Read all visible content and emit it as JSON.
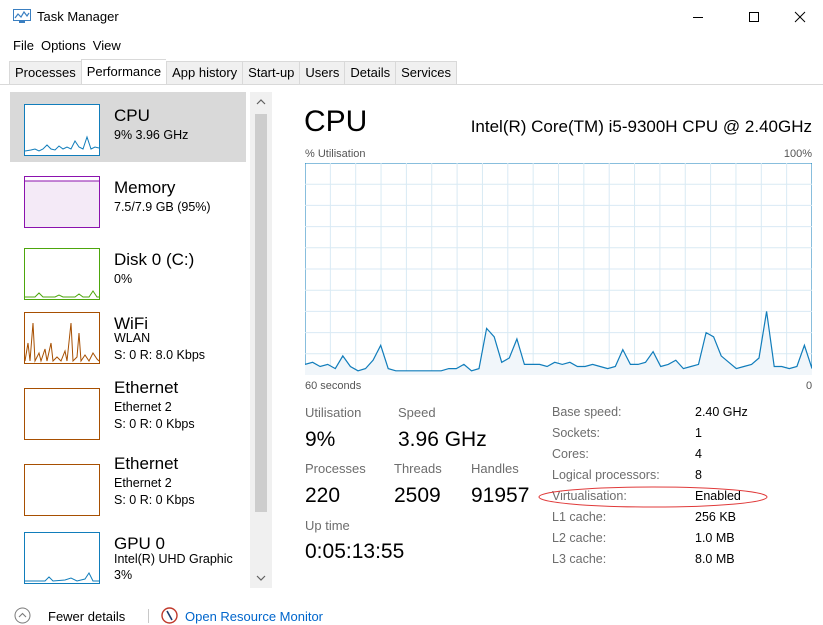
{
  "window": {
    "title": "Task Manager",
    "app_icon": "task-manager-icon",
    "controls": {
      "minimize": "minimize-icon",
      "maximize": "maximize-icon",
      "close": "close-icon"
    }
  },
  "menu": [
    "File",
    "Options",
    "View"
  ],
  "tabs": [
    {
      "label": "Processes",
      "active": false
    },
    {
      "label": "Performance",
      "active": true
    },
    {
      "label": "App history",
      "active": false
    },
    {
      "label": "Start-up",
      "active": false
    },
    {
      "label": "Users",
      "active": false
    },
    {
      "label": "Details",
      "active": false
    },
    {
      "label": "Services",
      "active": false
    }
  ],
  "sidebar": {
    "items": [
      {
        "title": "CPU",
        "line1": "9% 3.96 GHz",
        "line2": "",
        "color": "#117dbb",
        "selected": true
      },
      {
        "title": "Memory",
        "line1": "7.5/7.9 GB (95%)",
        "line2": "",
        "color": "#8b12ae",
        "selected": false
      },
      {
        "title": "Disk 0 (C:)",
        "line1": "0%",
        "line2": "",
        "color": "#4da60c",
        "selected": false
      },
      {
        "title": "WiFi",
        "line1": "WLAN",
        "line2": "S: 0 R: 8.0 Kbps",
        "color": "#a74f01",
        "selected": false
      },
      {
        "title": "Ethernet",
        "line1": "Ethernet 2",
        "line2": "S: 0 R: 0 Kbps",
        "color": "#a74f01",
        "selected": false
      },
      {
        "title": "Ethernet",
        "line1": "Ethernet 2",
        "line2": "S: 0 R: 0 Kbps",
        "color": "#a74f01",
        "selected": false
      },
      {
        "title": "GPU 0",
        "line1": "Intel(R) UHD Graphic",
        "line2": "3%",
        "color": "#117dbb",
        "selected": false
      }
    ]
  },
  "main": {
    "title": "CPU",
    "model": "Intel(R) Core(TM) i5-9300H CPU @ 2.40GHz",
    "graph": {
      "y_label": "% Utilisation",
      "y_max_label": "100%",
      "x_left_label": "60 seconds",
      "x_right_label": "0",
      "line_color": "#117dbb",
      "fill_color": "#f1f6fa",
      "grid_color": "#d9eaf4",
      "samples": [
        5,
        6,
        4,
        5,
        3,
        9,
        4,
        2,
        3,
        7,
        14,
        3,
        2,
        2,
        2,
        2,
        2,
        2,
        2,
        3,
        3,
        5,
        2,
        3,
        22,
        18,
        6,
        8,
        17,
        5,
        5,
        5,
        4,
        6,
        5,
        6,
        4,
        4,
        5,
        4,
        3,
        4,
        12,
        5,
        5,
        6,
        11,
        4,
        5,
        7,
        3,
        4,
        5,
        20,
        18,
        9,
        6,
        3,
        4,
        5,
        8,
        30,
        4,
        4,
        3,
        4,
        14,
        3
      ]
    },
    "stats": {
      "utilisation_label": "Utilisation",
      "utilisation_value": "9%",
      "speed_label": "Speed",
      "speed_value": "3.96 GHz",
      "processes_label": "Processes",
      "processes_value": "220",
      "threads_label": "Threads",
      "threads_value": "2509",
      "handles_label": "Handles",
      "handles_value": "91957",
      "uptime_label": "Up time",
      "uptime_value": "0:05:13:55"
    },
    "specs": [
      {
        "label": "Base speed:",
        "value": "2.40 GHz"
      },
      {
        "label": "Sockets:",
        "value": "1"
      },
      {
        "label": "Cores:",
        "value": "4"
      },
      {
        "label": "Logical processors:",
        "value": "8"
      },
      {
        "label": "Virtualisation:",
        "value": "Enabled"
      },
      {
        "label": "L1 cache:",
        "value": "256 KB"
      },
      {
        "label": "L2 cache:",
        "value": "1.0 MB"
      },
      {
        "label": "L3 cache:",
        "value": "8.0 MB"
      }
    ],
    "annotation_color": "#e03a3a"
  },
  "footer": {
    "fewer_details": "Fewer details",
    "open_resource_monitor": "Open Resource Monitor",
    "link_color": "#0066cc"
  }
}
